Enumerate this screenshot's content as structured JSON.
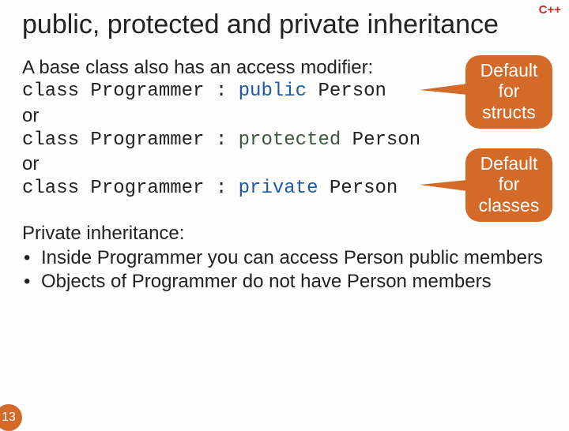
{
  "badge": "C++",
  "title": "public, protected and private inheritance",
  "intro": "A base class also has an access modifier:",
  "code": {
    "l1_a": "class Programmer : ",
    "l1_kw": "public",
    "l1_b": " Person",
    "l2": "or",
    "l3_a": "class Programmer : ",
    "l3_kw": "protected",
    "l3_b": " Person",
    "l4": "or",
    "l5_a": "class Programmer : ",
    "l5_kw": "private",
    "l5_b": " Person"
  },
  "callouts": {
    "structs": "Default for structs",
    "classes": "Default for classes"
  },
  "section2_title": "Private inheritance:",
  "bullets": [
    "Inside Programmer you can access Person public members",
    "Objects of Programmer do not have Person members"
  ],
  "page": "13"
}
